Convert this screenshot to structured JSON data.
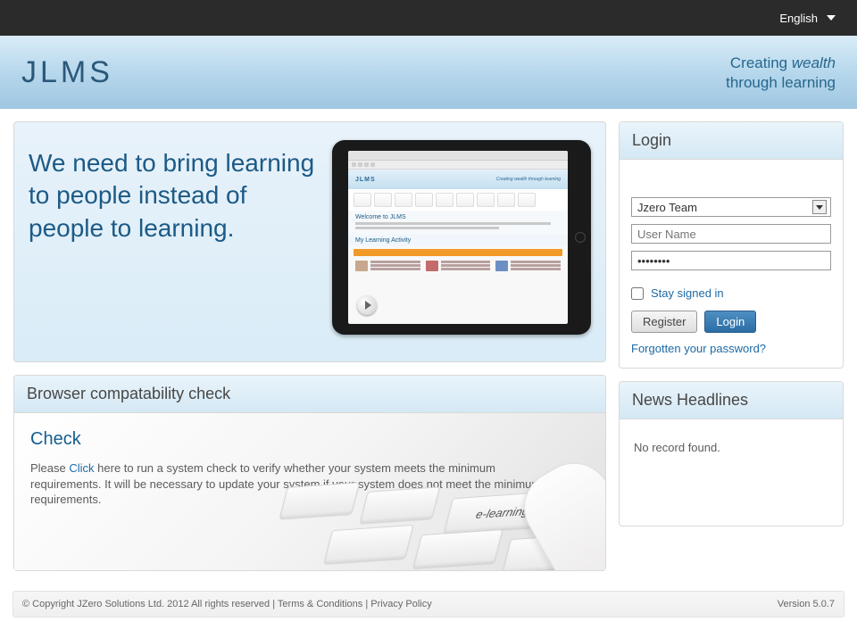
{
  "topbar": {
    "language": "English"
  },
  "header": {
    "logo": "JLMS",
    "tagline1a": "Creating ",
    "tagline1b": "wealth",
    "tagline2": "through learning"
  },
  "hero": {
    "text": "We need to bring learning to people instead of people to learning.",
    "mini_logo": "JLMS",
    "mini_tag": "Creating wealth through learning",
    "mini_welcome": "Welcome to JLMS",
    "mini_activity": "My Learning Activity",
    "mini_cards": [
      {
        "t1": "TV Watching",
        "t2": "Could be",
        "t3": "Cardiovascular",
        "t4": "Disease"
      },
      {
        "t1": "Delayed",
        "t2": "Cardiac Surgery",
        "t3": "Critical to",
        "t4": "increased"
      },
      {
        "t1": "Percutaneous",
        "t2": "Aortic Valve",
        "t3": "Replacement is",
        "t4": "increasing"
      }
    ]
  },
  "compat": {
    "header": "Browser compatability check",
    "title": "Check",
    "pre": "Please ",
    "link": "Click",
    "post": " here to run a system check to verify whether your system meets the minimum requirements. It will be necessary to update your system if your system does not meet the minimum requirements.",
    "key_label": "e-learning"
  },
  "login": {
    "header": "Login",
    "team": "Jzero Team",
    "username_placeholder": "User Name",
    "username_value": "",
    "password_value": "••••••••",
    "stay": "Stay signed in",
    "register": "Register",
    "login": "Login",
    "forgot": "Forgotten your password?"
  },
  "news": {
    "header": "News Headlines",
    "empty": "No record found."
  },
  "footer": {
    "copyright": "© Copyright JZero Solutions Ltd. 2012 All rights reserved",
    "sep": " | ",
    "terms": "Terms & Conditions",
    "privacy": "Privacy Policy",
    "version": "Version 5.0.7"
  }
}
